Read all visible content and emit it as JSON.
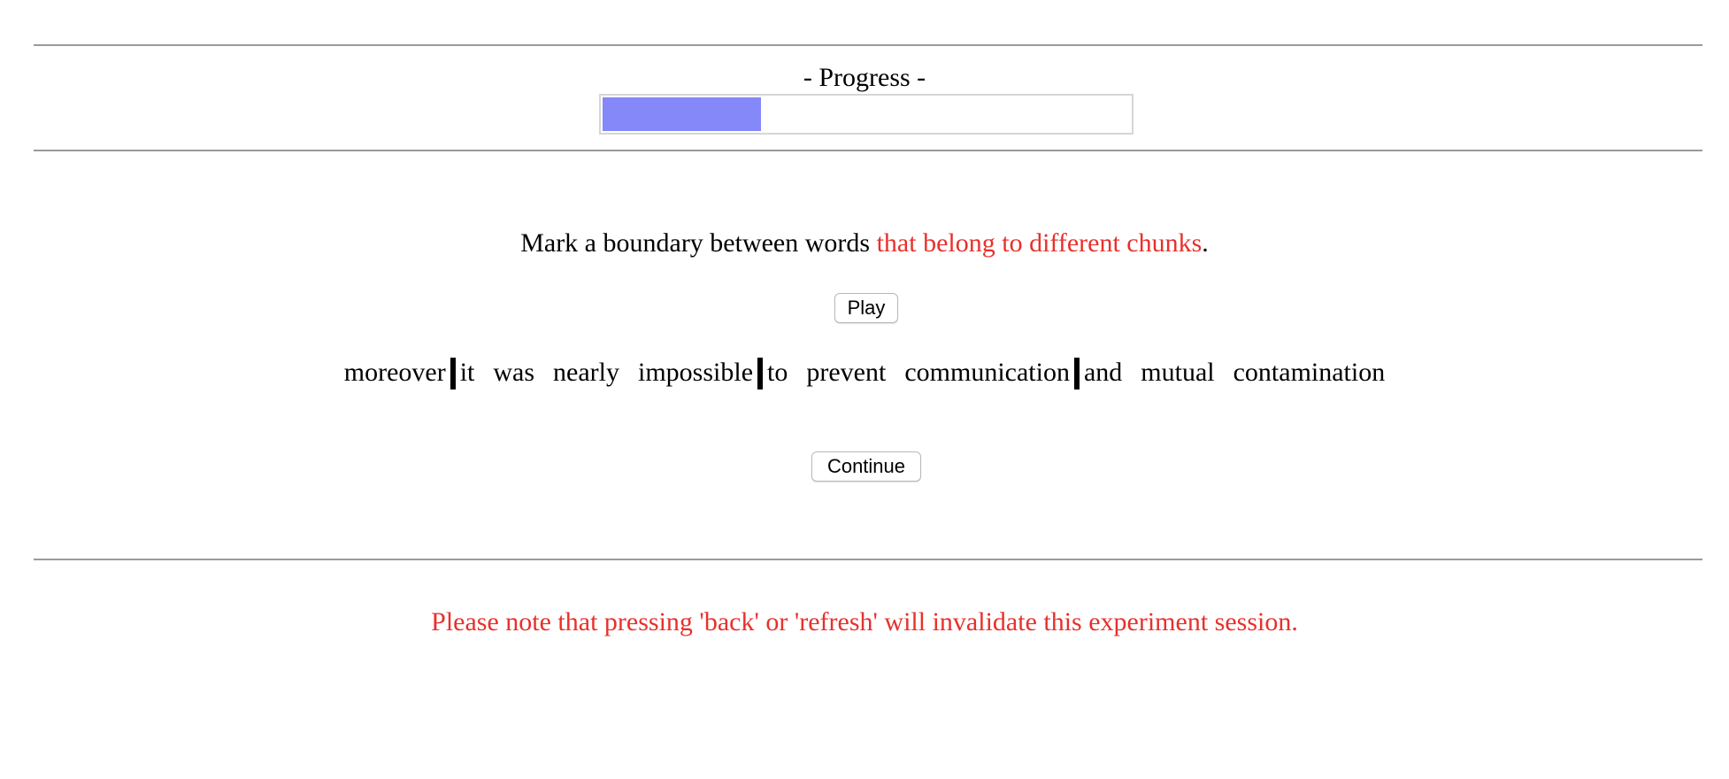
{
  "progress": {
    "label": "- Progress -",
    "fraction": 0.3
  },
  "instruction": {
    "prefix": "Mark a boundary between words ",
    "highlight": "that belong to different chunks",
    "suffix": "."
  },
  "buttons": {
    "play_label": "Play",
    "continue_label": "Continue"
  },
  "sentence": {
    "words": [
      "moreover",
      "it",
      "was",
      "nearly",
      "impossible",
      "to",
      "prevent",
      "communication",
      "and",
      "mutual",
      "contamination"
    ],
    "boundaries_after_word_index": [
      0,
      4,
      7
    ]
  },
  "warning": "Please note that pressing 'back' or 'refresh' will invalidate this experiment session.",
  "colors": {
    "highlight": "#e8302c",
    "progress_fill": "#8488f8",
    "rule": "#9a9a9a"
  }
}
